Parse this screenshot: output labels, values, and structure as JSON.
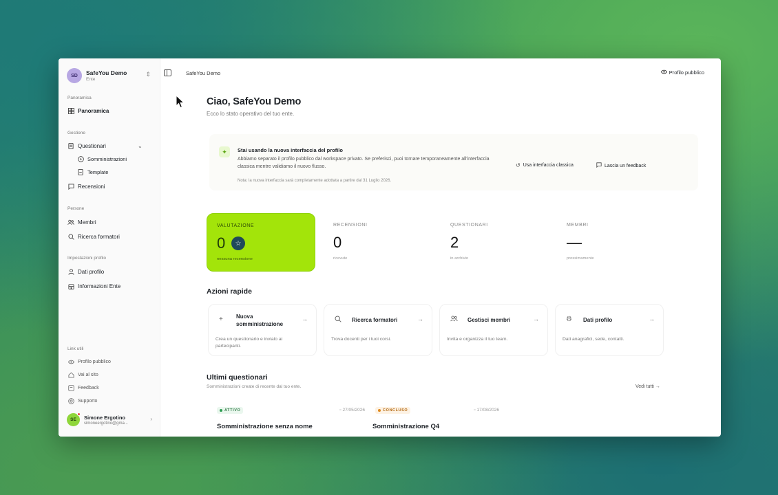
{
  "sidebar": {
    "workspace": {
      "initials": "SD",
      "name": "SafeYou Demo",
      "sub": "Ente"
    },
    "sections": {
      "overview": "Panoramica",
      "management": "Gestione",
      "people": "Persone",
      "profile_settings": "Impostazioni profilo",
      "useful_links": "Link utili"
    },
    "items": {
      "panoramica": "Panoramica",
      "questionari": "Questionari",
      "somministrazioni": "Somministrazioni",
      "template": "Template",
      "recensioni": "Recensioni",
      "membri": "Membri",
      "ricerca_formatori": "Ricerca formatori",
      "dati_profilo": "Dati profilo",
      "informazioni_ente": "Informazioni Ente",
      "profilo_pubblico": "Profilo pubblico",
      "vai_al_sito": "Vai al sito",
      "feedback": "Feedback",
      "supporto": "Supporto"
    },
    "user": {
      "initials": "SE",
      "name": "Simone Ergotino",
      "email": "simoneergotino@gma..."
    }
  },
  "header": {
    "breadcrumb": "SafeYou Demo",
    "public_profile": "Profilo pubblico"
  },
  "main": {
    "greeting": "Ciao, SafeYou Demo",
    "subtitle": "Ecco lo stato operativo del tuo ente.",
    "notice": {
      "title": "Stai usando la nuova interfaccia del profilo",
      "body": "Abbiamo separato il profilo pubblico dal workspace privato. Se preferisci, puoi tornare temporaneamente all'interfaccia classica mentre validiamo il nuovo flusso.",
      "note": "Nota: la nuova interfaccia sarà completamente adottata a partire dal 31 Luglio 2026.",
      "classic_btn": "Usa interfaccia classica",
      "feedback_btn": "Lascia un feedback"
    },
    "stats": [
      {
        "label": "VALUTAZIONE",
        "value": "0",
        "sub": "nessuna recensione"
      },
      {
        "label": "RECENSIONI",
        "value": "0",
        "sub": "ricevute"
      },
      {
        "label": "QUESTIONARI",
        "value": "2",
        "sub": "in archivio"
      },
      {
        "label": "MEMBRI",
        "value": "—",
        "sub": "prossimamente"
      }
    ],
    "quick_actions_title": "Azioni rapide",
    "quick_actions": [
      {
        "title": "Nuova somministrazione",
        "desc": "Crea un questionario e invialo ai partecipanti."
      },
      {
        "title": "Ricerca formatori",
        "desc": "Trova docenti per i tuoi corsi."
      },
      {
        "title": "Gestisci membri",
        "desc": "Invita e organizza il tuo team."
      },
      {
        "title": "Dati profilo",
        "desc": "Dati anagrafici, sede, contatti."
      }
    ],
    "latest_title": "Ultimi questionari",
    "latest_sub": "Somministrazioni create di recente dal tuo ente.",
    "see_all": "Vedi tutti",
    "cards": [
      {
        "status": "ATTIVO",
        "date": "27/05/2026",
        "title": "Somministrazione senza nome"
      },
      {
        "status": "CONCLUSO",
        "date": "17/08/2026",
        "title": "Somministrazione Q4"
      }
    ]
  }
}
